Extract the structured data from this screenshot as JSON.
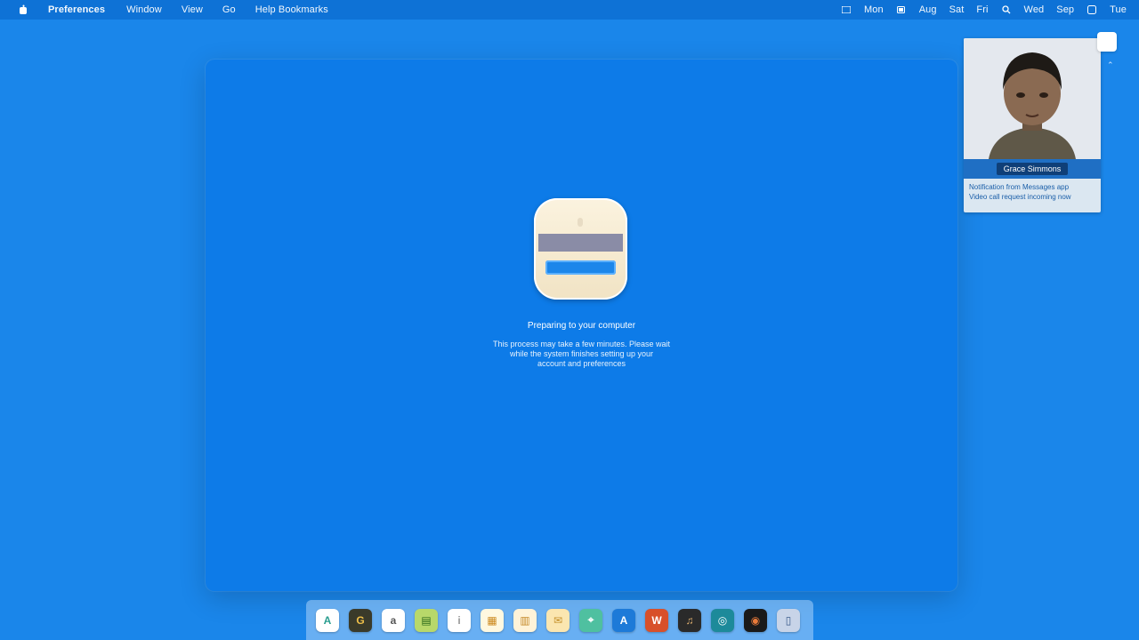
{
  "menubar": {
    "apple_icon": "apple-icon",
    "menus": [
      "Preferences",
      "Window",
      "View",
      "Go",
      "Help Bookmarks"
    ],
    "status_items": [
      "Mon",
      "Aug",
      "Sat",
      "Fri",
      "Wed",
      "Sep",
      "Tue"
    ],
    "status_icons": [
      "wifi-icon",
      "battery-icon",
      "search-icon",
      "control-center-icon"
    ]
  },
  "main": {
    "message_title": "Preparing to your computer",
    "message_lines": [
      "This process may take a few minutes. Please wait",
      "while the system finishes setting up your",
      "account and preferences"
    ],
    "icon": "app-installer-icon"
  },
  "contact": {
    "name": "Grace Simmons",
    "info_lines": [
      "Notification from Messages app",
      "Video call request incoming now"
    ]
  },
  "dock": {
    "items": [
      {
        "name": "finder",
        "glyph": "A",
        "bg": "#ffffff",
        "fg": "#2a9d8f"
      },
      {
        "name": "chrome",
        "glyph": "G",
        "bg": "#3a3a2a",
        "fg": "#f0c04a"
      },
      {
        "name": "text-edit",
        "glyph": "a",
        "bg": "#ffffff",
        "fg": "#555555"
      },
      {
        "name": "numbers",
        "glyph": "▤",
        "bg": "#b8d86a",
        "fg": "#2d6a1a"
      },
      {
        "name": "notes",
        "glyph": "i",
        "bg": "#ffffff",
        "fg": "#999999"
      },
      {
        "name": "calendar",
        "glyph": "▦",
        "bg": "#fff8e0",
        "fg": "#cc8a20"
      },
      {
        "name": "photos",
        "glyph": "▥",
        "bg": "#fff3d8",
        "fg": "#c58a2a"
      },
      {
        "name": "mail",
        "glyph": "✉",
        "bg": "#fbe6b0",
        "fg": "#c48f2a"
      },
      {
        "name": "maps",
        "glyph": "⌖",
        "bg": "#4fc0a0",
        "fg": "#ffffff"
      },
      {
        "name": "app-store",
        "glyph": "A",
        "bg": "#1d7ad8",
        "fg": "#ffffff"
      },
      {
        "name": "office",
        "glyph": "W",
        "bg": "#d8502a",
        "fg": "#ffffff"
      },
      {
        "name": "music",
        "glyph": "♫",
        "bg": "#2a2a2a",
        "fg": "#e0b070"
      },
      {
        "name": "safari",
        "glyph": "◎",
        "bg": "#1d8a9a",
        "fg": "#ffffff"
      },
      {
        "name": "terminal",
        "glyph": "◉",
        "bg": "#1a1a1a",
        "fg": "#e87a3a"
      },
      {
        "name": "trash",
        "glyph": "▯",
        "bg": "#c8d4e8",
        "fg": "#3a5a8a"
      }
    ]
  }
}
